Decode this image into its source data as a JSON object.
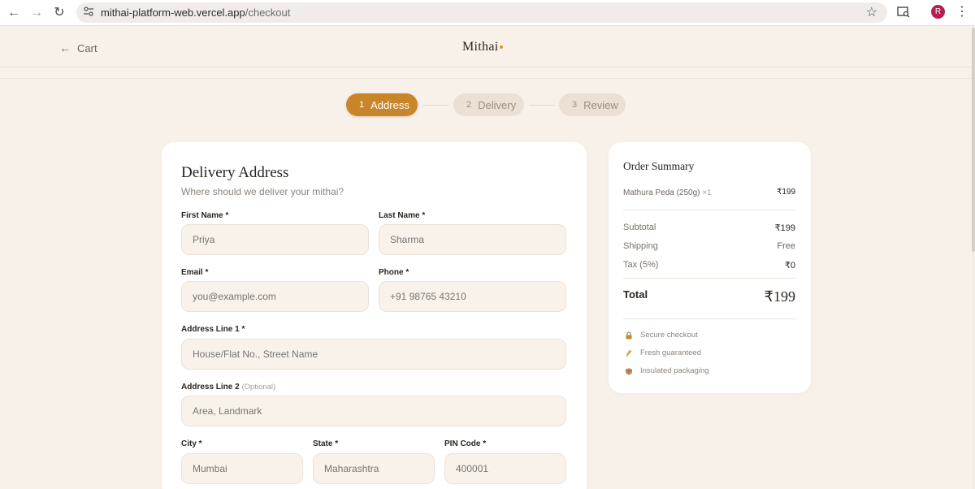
{
  "browser": {
    "url_host": "mithai-platform-web.vercel.app",
    "url_path": "/checkout",
    "avatar_letter": "R"
  },
  "header": {
    "back_label": "Cart",
    "brand": "Mithai"
  },
  "stepper": {
    "steps": [
      {
        "num": "1",
        "label": "Address",
        "state": "active"
      },
      {
        "num": "2",
        "label": "Delivery",
        "state": "inactive"
      },
      {
        "num": "3",
        "label": "Review",
        "state": "inactive"
      }
    ]
  },
  "form": {
    "title": "Delivery Address",
    "subtitle": "Where should we deliver your mithai?",
    "fields": {
      "first_name": {
        "label": "First Name *",
        "placeholder": "Priya"
      },
      "last_name": {
        "label": "Last Name *",
        "placeholder": "Sharma"
      },
      "email": {
        "label": "Email *",
        "placeholder": "you@example.com"
      },
      "phone": {
        "label": "Phone *",
        "placeholder": "+91 98765 43210"
      },
      "address1": {
        "label": "Address Line 1 *",
        "placeholder": "House/Flat No., Street Name"
      },
      "address2": {
        "label": "Address Line 2",
        "optional": "(Optional)",
        "placeholder": "Area, Landmark"
      },
      "city": {
        "label": "City *",
        "placeholder": "Mumbai"
      },
      "state": {
        "label": "State *",
        "placeholder": "Maharashtra"
      },
      "pin": {
        "label": "PIN Code *",
        "placeholder": "400001"
      }
    }
  },
  "summary": {
    "title": "Order Summary",
    "item": {
      "name": "Mathura Peda (250g)",
      "qty": "×1",
      "price": "₹199"
    },
    "subtotal_label": "Subtotal",
    "subtotal_value": "₹199",
    "shipping_label": "Shipping",
    "shipping_value": "Free",
    "tax_label": "Tax (5%)",
    "tax_value": "₹0",
    "total_label": "Total",
    "total_value": "₹199",
    "badges": [
      "Secure checkout",
      "Fresh guaranteed",
      "Insulated packaging"
    ]
  },
  "colors": {
    "accent": "#c8862a",
    "page_bg": "#f8f1ea",
    "input_bg": "#f8f2ea"
  }
}
